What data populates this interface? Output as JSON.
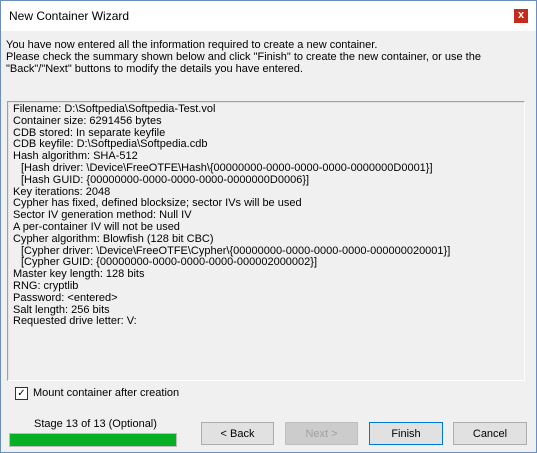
{
  "window": {
    "title": "New Container Wizard",
    "close_glyph": "x"
  },
  "intro": [
    "You have now entered all the information required to create a new container.",
    "Please check the summary shown below and click \"Finish\" to create the new container, or use the",
    "\"Back\"/\"Next\" buttons to modify the details you have entered."
  ],
  "summary": [
    {
      "text": "Filename: D:\\Softpedia\\Softpedia-Test.vol",
      "indent": false
    },
    {
      "text": "Container size: 6291456 bytes",
      "indent": false
    },
    {
      "text": "CDB stored: In separate keyfile",
      "indent": false
    },
    {
      "text": "CDB keyfile: D:\\Softpedia\\Softpedia.cdb",
      "indent": false
    },
    {
      "text": "Hash algorithm: SHA-512",
      "indent": false
    },
    {
      "text": "[Hash driver: \\Device\\FreeOTFE\\Hash\\{00000000-0000-0000-0000-0000000D0001}]",
      "indent": true
    },
    {
      "text": "[Hash GUID: {00000000-0000-0000-0000-0000000D0006}]",
      "indent": true
    },
    {
      "text": "Key iterations: 2048",
      "indent": false
    },
    {
      "text": "Cypher has fixed, defined blocksize; sector IVs will be used",
      "indent": false
    },
    {
      "text": "Sector IV generation method: Null IV",
      "indent": false
    },
    {
      "text": "A per-container IV will not be used",
      "indent": false
    },
    {
      "text": "Cypher algorithm: Blowfish (128 bit CBC)",
      "indent": false
    },
    {
      "text": "[Cypher driver: \\Device\\FreeOTFE\\Cypher\\{00000000-0000-0000-0000-000000020001}]",
      "indent": true
    },
    {
      "text": "[Cypher GUID: {00000000-0000-0000-0000-000002000002}]",
      "indent": true
    },
    {
      "text": "Master key length: 128 bits",
      "indent": false
    },
    {
      "text": "RNG: cryptlib",
      "indent": false
    },
    {
      "text": "Password: <entered>",
      "indent": false
    },
    {
      "text": "Salt length: 256 bits",
      "indent": false
    },
    {
      "text": "Requested drive letter: V:",
      "indent": false
    }
  ],
  "mount_checkbox": {
    "label": "Mount container after creation",
    "checked": true,
    "check_glyph": "✓"
  },
  "stage": {
    "label": "Stage 13 of 13 (Optional)",
    "progress": 1.0,
    "color": "#06b025"
  },
  "buttons": {
    "back": "< Back",
    "next": "Next >",
    "finish": "Finish",
    "cancel": "Cancel"
  }
}
